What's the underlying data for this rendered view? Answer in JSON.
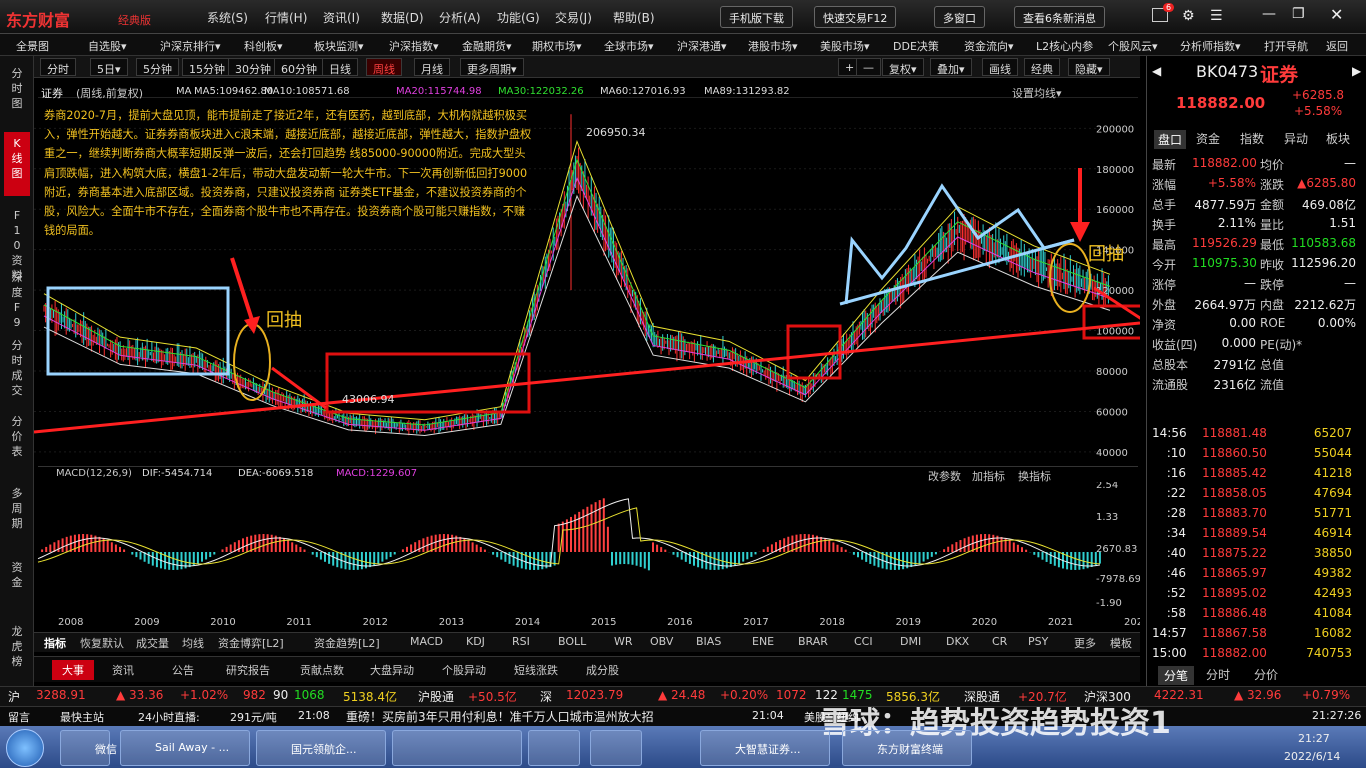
{
  "app": {
    "brand": "东方财富",
    "edition": "经典版",
    "menu": [
      "系统(S)",
      "行情(H)",
      "资讯(I)",
      "数据(D)",
      "分析(A)",
      "功能(G)",
      "交易(J)",
      "帮助(B)"
    ],
    "buttons": [
      "手机版下载",
      "快速交易F12",
      "多窗口",
      "查看6条新消息"
    ],
    "msg_count": "6"
  },
  "nav": [
    "全景图",
    "自选股▾",
    "沪深京排行▾",
    "科创板▾",
    "板块监测▾",
    "沪深指数▾",
    "金融期货▾",
    "期权市场▾",
    "全球市场▾",
    "沪深港通▾",
    "港股市场▾",
    "美股市场▾",
    "DDE决策",
    "资金流向▾",
    "L2核心内参",
    "个股风云▾",
    "分析师指数▾",
    "打开导航",
    "返回"
  ],
  "left_tabs": [
    "分时图",
    "K线图",
    "F10资料",
    "深度F9",
    "分时成交",
    "分价表",
    "多周期",
    "资金",
    "龙虎榜"
  ],
  "timeframes": [
    "分时",
    "5日▾",
    "5分钟",
    "15分钟",
    "30分钟",
    "60分钟",
    "日线",
    "周线",
    "月线",
    "更多周期▾"
  ],
  "active_tf": "周线",
  "right_tools": [
    "+",
    "—",
    "复权▾",
    "叠加▾",
    "画线",
    "经典",
    "隐藏▾"
  ],
  "chart_header": {
    "name": "证券",
    "mode": "(周线,前复权)",
    "ma": [
      {
        "label": "MA",
        "color": "#ddd"
      },
      {
        "label": "MA5:109462.80",
        "color": "#ddd"
      },
      {
        "label": "MA10:108571.68",
        "color": "#ddd"
      },
      {
        "label": "MA20:115744.98",
        "color": "#e040e0"
      },
      {
        "label": "MA30:122032.26",
        "color": "#30e030"
      },
      {
        "label": "MA60:127016.93",
        "color": "#ddd"
      },
      {
        "label": "MA89:131293.82",
        "color": "#ddd"
      }
    ],
    "setting": "设置均线▾"
  },
  "annotation": "券商2020-7月，提前大盘见顶，能市提前走了接近2年，还有医药，越到底部，大机构就越积极买入，弹性开始越大。证券券商板块进入c浪末端，越接近底部，越接近底部，弹性越大，指数护盘权重之一，继续判断券商大概率短期反弹一波后，还会打回趋势 线85000-90000附近。完成大型头肩顶跌幅，进入构筑大底，横盘1-2年后，带动大盘发动新一轮大牛市。下一次再创新低回打9000附近，券商基本进入底部区域。投资券商，只建议投资券商 证券类ETF基金，不建议投资券商的个股，风险大。全面牛市不存在，全面券商个股牛市也不再存在。投资券商个股可能只赚指数，不赚钱的局面。",
  "chart_labels": {
    "huichou1": "回抽",
    "huichou2": "回抽",
    "peak": "206950.34",
    "low": "43006.94"
  },
  "chart_data": {
    "type": "line",
    "x": [
      "2008",
      "2009",
      "2010",
      "2011",
      "2012",
      "2013",
      "2014",
      "2015",
      "2016",
      "2017",
      "2018",
      "2019",
      "2020",
      "2021",
      "2022"
    ],
    "y_ticks": [
      200000,
      180000,
      160000,
      140000,
      120000,
      100000,
      80000,
      60000,
      40000
    ],
    "series": [
      {
        "values": [
          110000,
          90000,
          85000,
          68000,
          55000,
          52000,
          58000,
          180000,
          95000,
          88000,
          70000,
          112000,
          150000,
          132000,
          118882
        ]
      }
    ],
    "peak": 206950.34,
    "low": 43006.94
  },
  "macd": {
    "label": "MACD(12,26,9)",
    "dif": "DIF:-5454.714",
    "dea": "DEA:-6069.518",
    "macd": "MACD:1229.607",
    "tools": [
      "改参数",
      "加指标",
      "换指标"
    ],
    "y_ticks": [
      "2.54",
      "1.33",
      "2670.83",
      "-7978.69",
      "-1.90"
    ]
  },
  "indicators": [
    "指标",
    "恢复默认",
    "成交量",
    "均线",
    "资金博弈[L2]",
    "资金趋势[L2]",
    "MACD",
    "KDJ",
    "RSI",
    "BOLL",
    "WR",
    "OBV",
    "BIAS",
    "ENE",
    "BRAR",
    "CCI",
    "DMI",
    "DKX",
    "CR",
    "PSY",
    "更多",
    "模板"
  ],
  "bottom_tabs": [
    "大事",
    "资讯",
    "公告",
    "研究报告",
    "贡献点数",
    "大盘异动",
    "个股异动",
    "短线涨跌",
    "成分股"
  ],
  "quote": {
    "code": "BK0473",
    "name": "证券",
    "price": "118882.00",
    "change": "+6285.8",
    "pct": "+5.58%",
    "tabs": [
      "盘口",
      "资金",
      "指数",
      "异动",
      "板块"
    ],
    "rows": [
      [
        "最新",
        "118882.00",
        "均价",
        "—"
      ],
      [
        "涨幅",
        "+5.58%",
        "涨跌",
        "▲6285.80"
      ],
      [
        "总手",
        "4877.59万",
        "金额",
        "469.08亿"
      ],
      [
        "换手",
        "2.11%",
        "量比",
        "1.51"
      ],
      [
        "最高",
        "119526.29",
        "最低",
        "110583.68"
      ],
      [
        "今开",
        "110975.30",
        "昨收",
        "112596.20"
      ],
      [
        "涨停",
        "—",
        "跌停",
        "—"
      ],
      [
        "外盘",
        "2664.97万",
        "内盘",
        "2212.62万"
      ],
      [
        "净资",
        "0.00",
        "ROE",
        "0.00%"
      ],
      [
        "收益(四)",
        "0.000",
        "PE(动)*",
        ""
      ],
      [
        "总股本",
        "2791亿",
        "总值",
        ""
      ],
      [
        "流通股",
        "2316亿",
        "流值",
        ""
      ]
    ],
    "ticks": [
      [
        "14:56",
        "118881.48",
        "65207"
      ],
      [
        ":10",
        "118860.50",
        "55044"
      ],
      [
        ":16",
        "118885.42",
        "41218"
      ],
      [
        ":22",
        "118858.05",
        "47694"
      ],
      [
        ":28",
        "118883.70",
        "51771"
      ],
      [
        ":34",
        "118889.54",
        "46914"
      ],
      [
        ":40",
        "118875.22",
        "38850"
      ],
      [
        ":46",
        "118865.97",
        "49382"
      ],
      [
        ":52",
        "118895.02",
        "42493"
      ],
      [
        ":58",
        "118886.48",
        "41084"
      ],
      [
        "14:57",
        "118867.58",
        "16082"
      ],
      [
        "15:00",
        "118882.00",
        "740753"
      ]
    ],
    "btm_tabs": [
      "分笔",
      "分时",
      "分价"
    ]
  },
  "index_bar": [
    [
      "沪",
      "3288.91",
      "▲ 33.36",
      "+1.02%",
      "982",
      "90",
      "1068",
      "5138.4亿"
    ],
    [
      "沪股通",
      "+50.5亿"
    ],
    [
      "深",
      "12023.79",
      "▲ 24.48",
      "+0.20%",
      "1072",
      "122",
      "1475",
      "5856.3亿"
    ],
    [
      "深股通",
      "+20.7亿"
    ],
    [
      "沪深300",
      "4222.31",
      "▲ 32.96",
      "+0.79%"
    ]
  ],
  "news": {
    "left": "留言",
    "fast": "最快主站",
    "live": "24小时直播:",
    "price": "291元/吨",
    "t1": "21:08",
    "headline": "重磅！买房前3年只用付利息！准千万人口城市温州放大招",
    "t2": "21:04",
    "tail": "美股：纽约",
    "time": "21:27:26"
  },
  "watermark": "雪球：趋势投资趋势投资1",
  "taskbar": {
    "items": [
      "微信",
      "Sail Away - ...",
      "国元领航企...",
      "",
      "",
      "",
      "大智慧证券...",
      "东方财富终端"
    ],
    "time": "21:27",
    "date": "2022/6/14"
  }
}
